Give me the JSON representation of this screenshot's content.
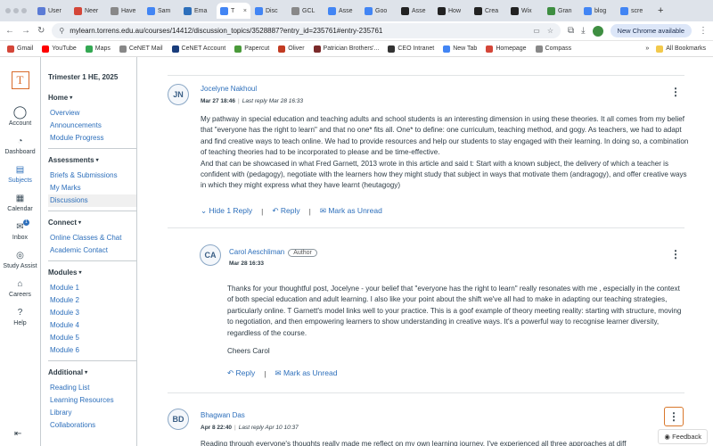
{
  "browser": {
    "tabs": [
      {
        "label": "User",
        "color": "#5b7bd5"
      },
      {
        "label": "Neer",
        "color": "#d44638"
      },
      {
        "label": "Have",
        "color": "#888888"
      },
      {
        "label": "Sam",
        "color": "#4285f4"
      },
      {
        "label": "Ema",
        "color": "#2d6fbb"
      },
      {
        "label": "T",
        "color": "#4285f4",
        "active": true
      },
      {
        "label": "Disc",
        "color": "#4285f4"
      },
      {
        "label": "GCL",
        "color": "#888888"
      },
      {
        "label": "Asse",
        "color": "#4285f4"
      },
      {
        "label": "Goo",
        "color": "#4285f4"
      },
      {
        "label": "Asse",
        "color": "#222222"
      },
      {
        "label": "How",
        "color": "#222222"
      },
      {
        "label": "Crea",
        "color": "#222222"
      },
      {
        "label": "Wix",
        "color": "#222222"
      },
      {
        "label": "Gran",
        "color": "#3e8e41"
      },
      {
        "label": "blog",
        "color": "#4285f4"
      },
      {
        "label": "scre",
        "color": "#4285f4"
      }
    ],
    "url": "mylearn.torrens.edu.au/courses/14412/discussion_topics/3528887?entry_id=235761#entry-235761",
    "update_label": "New Chrome available",
    "bookmarks": [
      {
        "label": "Gmail",
        "color": "#d44638"
      },
      {
        "label": "YouTube",
        "color": "#ff0000"
      },
      {
        "label": "Maps",
        "color": "#34a853"
      },
      {
        "label": "CeNET Mail",
        "color": "#888888"
      },
      {
        "label": "CeNET Account",
        "color": "#1a3d7c"
      },
      {
        "label": "Papercut",
        "color": "#4a9a3a"
      },
      {
        "label": "Oliver",
        "color": "#c23b22"
      },
      {
        "label": "Patrician Brothers'...",
        "color": "#7a2a2a"
      },
      {
        "label": "CEO Intranet",
        "color": "#333333"
      },
      {
        "label": "New Tab",
        "color": "#4285f4"
      },
      {
        "label": "Homepage",
        "color": "#d44638"
      },
      {
        "label": "Compass",
        "color": "#888888"
      }
    ],
    "all_bookmarks": "All Bookmarks"
  },
  "global_nav": [
    {
      "label": "Account",
      "icon": "account-icon"
    },
    {
      "label": "Dashboard",
      "icon": "dashboard-icon"
    },
    {
      "label": "Subjects",
      "icon": "subjects-icon",
      "active": true
    },
    {
      "label": "Calendar",
      "icon": "calendar-icon"
    },
    {
      "label": "Inbox",
      "icon": "inbox-icon",
      "badge": "1"
    },
    {
      "label": "Study Assist",
      "icon": "lightbulb-icon"
    },
    {
      "label": "Careers",
      "icon": "careers-icon"
    },
    {
      "label": "Help",
      "icon": "help-icon"
    }
  ],
  "course_nav": {
    "term": "Trimester 1 HE, 2025",
    "sections": [
      {
        "title": "Home",
        "links": [
          "Overview",
          "Announcements",
          "Module Progress"
        ]
      },
      {
        "title": "Assessments",
        "links": [
          "Briefs & Submissions",
          "My Marks",
          "Discussions"
        ]
      },
      {
        "title": "Connect",
        "links": [
          "Online Classes & Chat",
          "Academic Contact"
        ]
      },
      {
        "title": "Modules",
        "links": [
          "Module 1",
          "Module 2",
          "Module 3",
          "Module 4",
          "Module 5",
          "Module 6"
        ]
      },
      {
        "title": "Additional",
        "links": [
          "Reading List",
          "Learning Resources",
          "Library",
          "Collaborations"
        ]
      }
    ]
  },
  "posts": [
    {
      "initials": "JN",
      "author": "Jocelyne Nakhoul",
      "date": "Mar 27 18:46",
      "last_reply": "Last reply Mar 28 16:33",
      "paragraphs": [
        "My pathway in special education and teaching adults and school students is an interesting dimension in using these theories. It all comes from my belief that \"everyone has the right to learn\" and that no one* fits all. One* to define: one curriculum, teaching method, and gogy. As teachers, we had to adapt and find creative ways to teach online. We had to provide resources and help our students to stay engaged with their learning. In doing so, a combination of teaching theories had to be incorporated to please and be time-effective.",
        "And that can be showcased in what Fred Garnett, 2013 wrote in this article and said t: Start with a known subject, the delivery of which a teacher is confident with (pedagogy), negotiate with the learners how they might study that subject in ways that motivate them (andragogy), and offer creative ways in which they might express what they have learnt (heutagogy)"
      ],
      "hide_label": "Hide 1 Reply",
      "reply_label": "Reply",
      "unread_label": "Mark as Unread"
    },
    {
      "initials": "CA",
      "author": "Carol Aeschliman",
      "role": "Author",
      "date": "Mar 28 16:33",
      "paragraphs": [
        "Thanks for your thoughtful post, Jocelyne  - your belief that \"everyone has the right to learn\" really resonates with me , especially in the context of both special education and adult learning. I also like your point about the shift we've all had to make in adapting our teaching strategies, particularly online. T Garnett's model links well to your practice. This is a goof example of theory meeting reality: starting with structure, moving to negotiation, and then empowering learners to show understanding in creative ways. It's a powerful way to recognise learner diversity, regardless of the course.",
        "Cheers Carol"
      ],
      "reply_label": "Reply",
      "unread_label": "Mark as Unread"
    },
    {
      "initials": "BD",
      "author": "Bhagwan Das",
      "date": "Apr 8 22:40",
      "last_reply": "Last reply Apr 10 10:37",
      "paragraphs": [
        "Reading through everyone's thoughts really made me reflect on my own learning journey. I've experienced all three approaches at diff"
      ]
    }
  ],
  "feedback_label": "Feedback"
}
